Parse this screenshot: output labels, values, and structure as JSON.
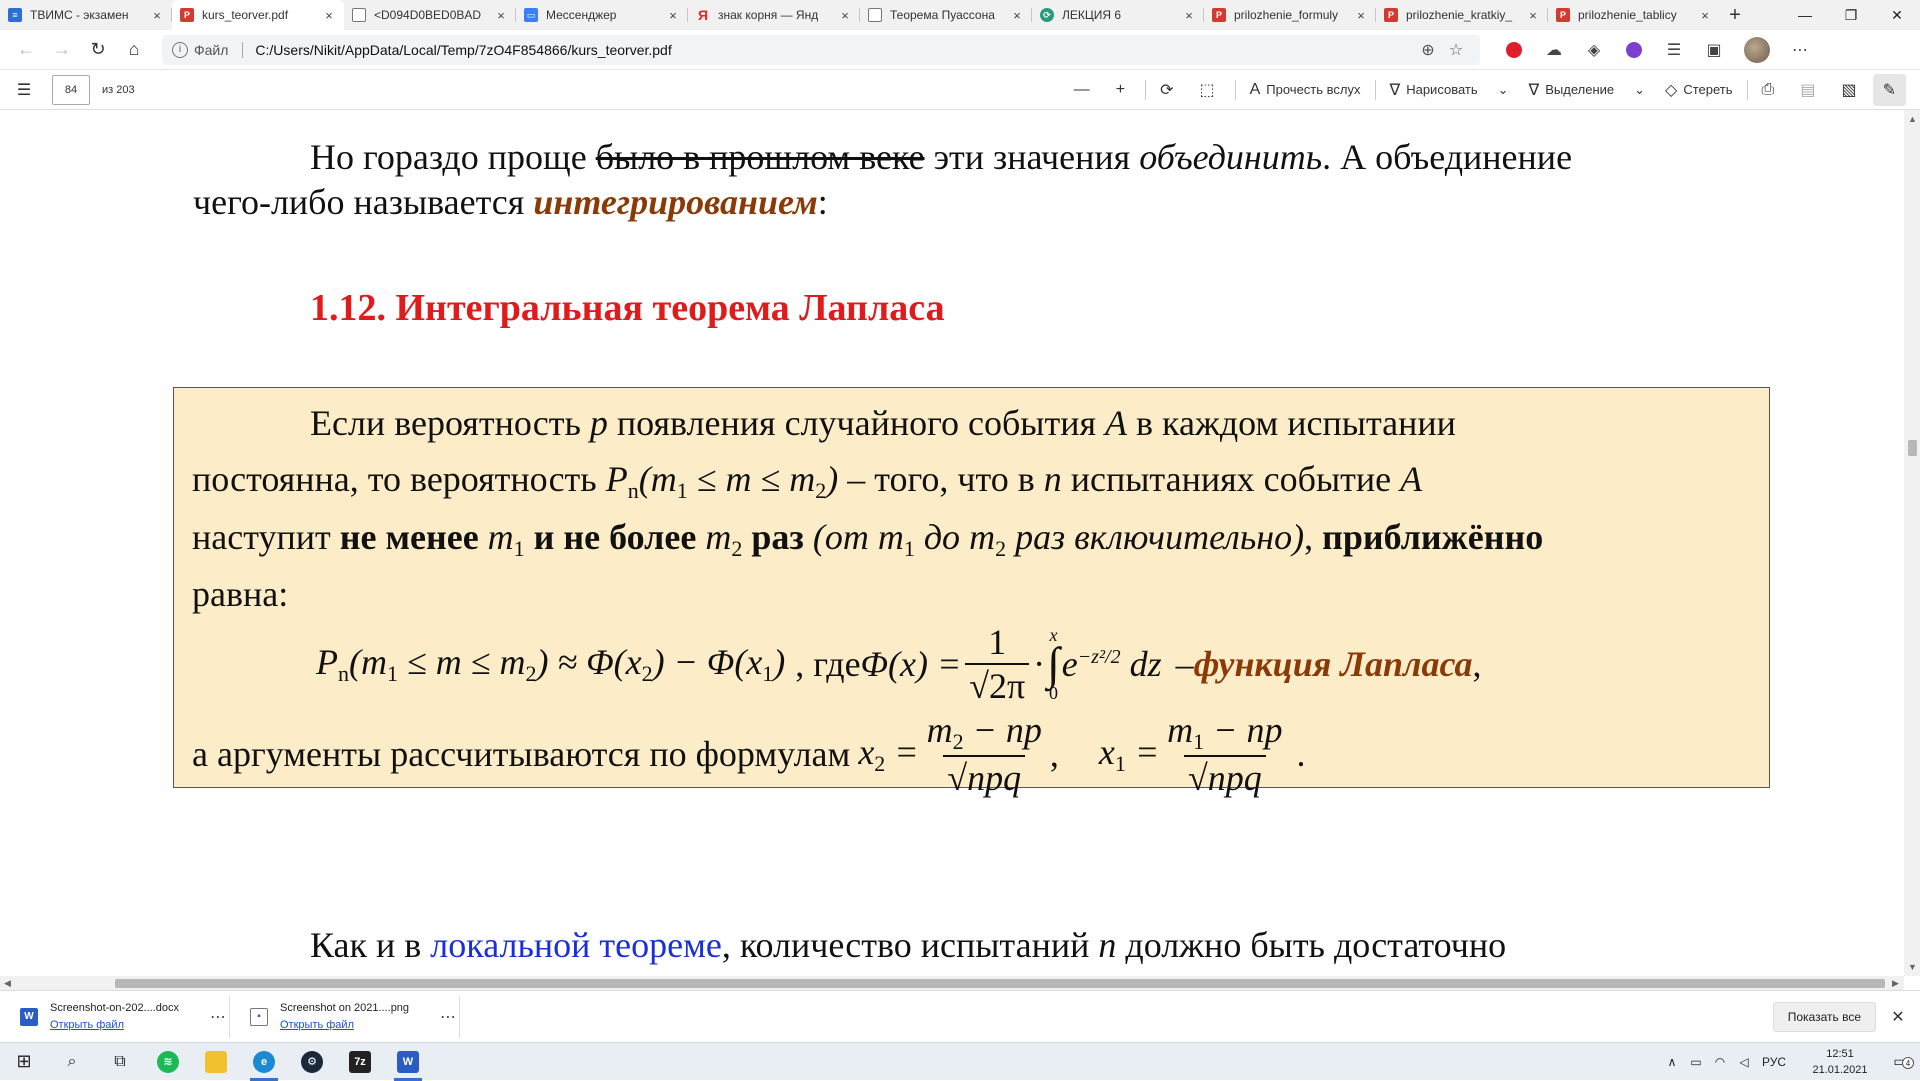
{
  "tabs": [
    {
      "title": "ТВИМС - экзамен",
      "icon": "doc-icon",
      "active": false
    },
    {
      "title": "kurs_teorver.pdf",
      "icon": "pdf-icon",
      "active": true
    },
    {
      "title": "<D094D0BED0BAD",
      "icon": "page-icon",
      "active": false
    },
    {
      "title": "Мессенджер",
      "icon": "messenger-icon",
      "active": false
    },
    {
      "title": "знак корня — Янд",
      "icon": "yandex-icon",
      "active": false
    },
    {
      "title": "Теорема Пуассона",
      "icon": "page-icon",
      "active": false
    },
    {
      "title": "ЛЕКЦИЯ 6",
      "icon": "lecture-icon",
      "active": false
    },
    {
      "title": "prilozhenie_formuly",
      "icon": "pdf-icon",
      "active": false
    },
    {
      "title": "prilozhenie_kratkiy_",
      "icon": "pdf-icon",
      "active": false
    },
    {
      "title": "prilozhenie_tablicy",
      "icon": "pdf-icon",
      "active": false
    }
  ],
  "address": {
    "label": "Файл",
    "url": "C:/Users/Nikit/AppData/Local/Temp/7zO4F854866/kurs_teorver.pdf"
  },
  "pdf_toolbar": {
    "page_number": "84",
    "page_count": "из 203",
    "read_aloud": "Прочесть вслух",
    "draw": "Нарисовать",
    "highlight": "Выделение",
    "erase": "Стереть"
  },
  "document": {
    "intro_part1": "Но гораздо проще ",
    "intro_strike": "было в прошлом веке",
    "intro_part2": " эти значения ",
    "intro_italic": "объединить",
    "intro_part3": ". А объединение",
    "intro_line2_a": "чего-либо называется ",
    "intro_line2_b": "интегрированием",
    "intro_line2_c": ":",
    "heading": "1.12. Интегральная теорема Лапласа",
    "theorem": {
      "l1_a": "Если вероятность ",
      "l1_p": "p",
      "l1_b": " появления случайного события ",
      "l1_A": "A",
      "l1_c": " в каждом испытании",
      "l2_a": "постоянна, то вероятность ",
      "l2_b": " – того, что в ",
      "l2_n": "n",
      "l2_c": " испытаниях событие ",
      "l2_A": "A",
      "l3_a": "наступит ",
      "l3_b": "не менее",
      "l3_c": " и не более",
      "l3_d": " раз",
      "l3_e": " (от ",
      "l3_f": " до ",
      "l3_g": " раз включительно)",
      "l3_h": ", ",
      "l3_i": "приближённо",
      "l4": "равна:",
      "formula_where": ", где ",
      "formula_laplace": "функция Лапласа",
      "args_text": "а аргументы рассчитываются по формулам "
    },
    "bottom_a": "Как и в ",
    "bottom_link": "локальной теореме",
    "bottom_b": ", количество испытаний ",
    "bottom_n": "n",
    "bottom_c": " должно быть достаточно"
  },
  "downloads": [
    {
      "name": "Screenshot-on-202....docx",
      "action": "Открыть файл",
      "icon": "word-icon"
    },
    {
      "name": "Screenshot on 2021....png",
      "action": "Открыть файл",
      "icon": "image-icon"
    }
  ],
  "show_all": "Показать все",
  "tray": {
    "lang": "РУС",
    "time": "12:51",
    "date": "21.01.2021",
    "notifications": "4"
  },
  "colors": {
    "heading": "#e01b1b",
    "emphasis": "#8a3a06",
    "theorem_bg": "#fdecc8",
    "link": "#1a2fd6"
  }
}
